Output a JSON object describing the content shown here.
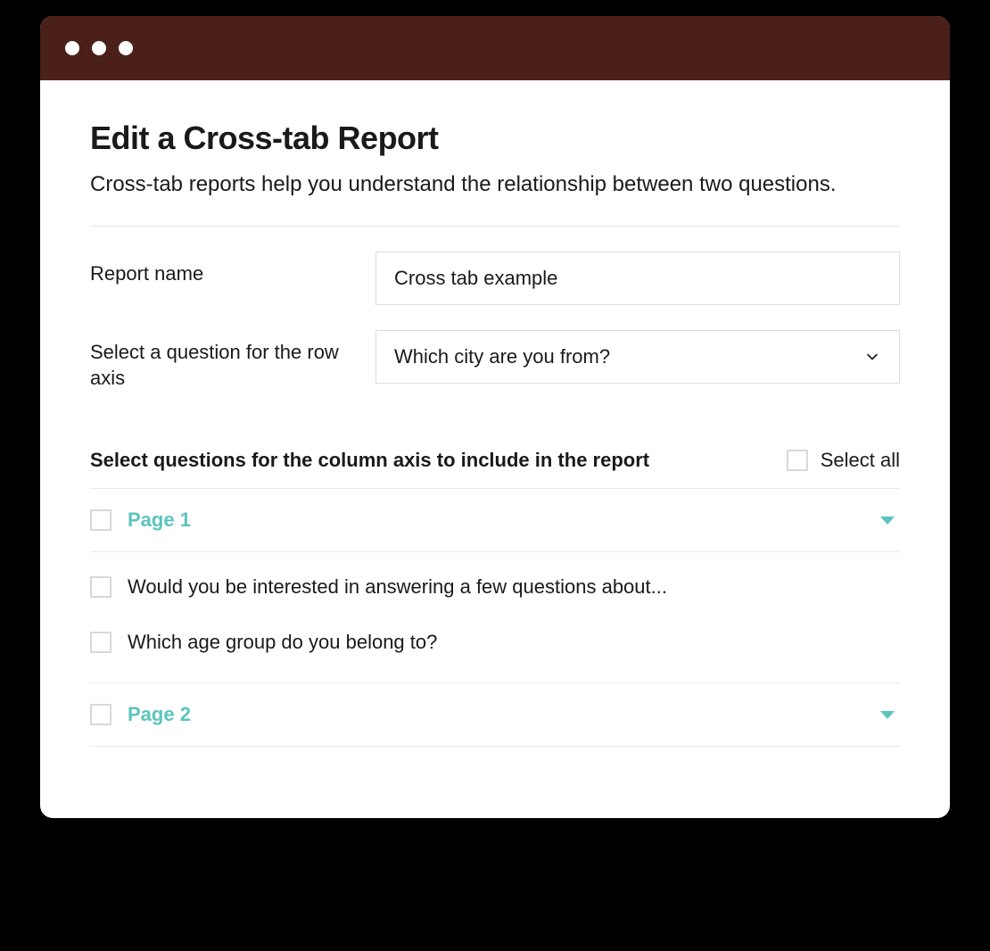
{
  "header": {
    "title": "Edit a Cross-tab Report",
    "subtitle": "Cross-tab reports help you understand the relationship between  two questions."
  },
  "fields": {
    "report_name_label": "Report name",
    "report_name_value": "Cross tab example",
    "row_axis_label": "Select a question for the row axis",
    "row_axis_value": "Which city are you from?"
  },
  "column_section": {
    "heading": "Select questions for the column axis to include in the report",
    "select_all_label": "Select all"
  },
  "pages": [
    {
      "label": "Page 1",
      "questions": [
        "Would you be interested in answering a few questions about...",
        "Which age group do you belong to?"
      ]
    },
    {
      "label": "Page 2",
      "questions": []
    }
  ]
}
